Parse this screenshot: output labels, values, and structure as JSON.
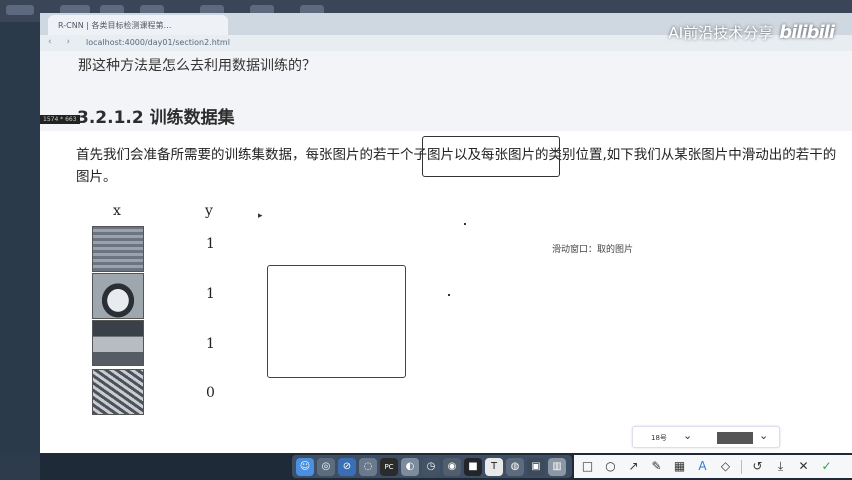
{
  "browser": {
    "tab_title": "R-CNN | 各类目标检测课程第…",
    "address": "localhost:4000/day01/section2.html",
    "nav_glyphs": "‹ ›"
  },
  "watermark": {
    "text": "AI前沿技术分享",
    "logo": "bilibili"
  },
  "page": {
    "question": "那这种方法是怎么去利用数据训练的？",
    "section_heading": "3.2.1.2 训练数据集",
    "size_tag": "1574 * 663",
    "paragraph": "首先我们会准备所需要的训练集数据，每张图片的若干个子图片以及每张图片的类别位置,如下我们从某张图片中滑动出的若干的图片。",
    "col_x": "x",
    "col_y": "y",
    "samples": [
      {
        "y": "1"
      },
      {
        "y": "1"
      },
      {
        "y": "1"
      },
      {
        "y": "0"
      }
    ],
    "slide_caption": "滑动窗口：取的图片"
  },
  "controls": {
    "font_size": "18号",
    "caret": "⌄",
    "color": "#555555"
  },
  "dock": {
    "icons": [
      "finder-icon",
      "safari-icon",
      "chrome-icon",
      "pycharm-icon",
      "app-icon",
      "clock-icon",
      "music-icon",
      "typora-icon",
      "misc-icon",
      "monitor-icon",
      "trash-icon"
    ]
  },
  "toolbar": {
    "tools": [
      "□",
      "○",
      "↗",
      "✎",
      "▦",
      "A",
      "◇",
      "↺",
      "⤓",
      "✕",
      "✓"
    ]
  }
}
